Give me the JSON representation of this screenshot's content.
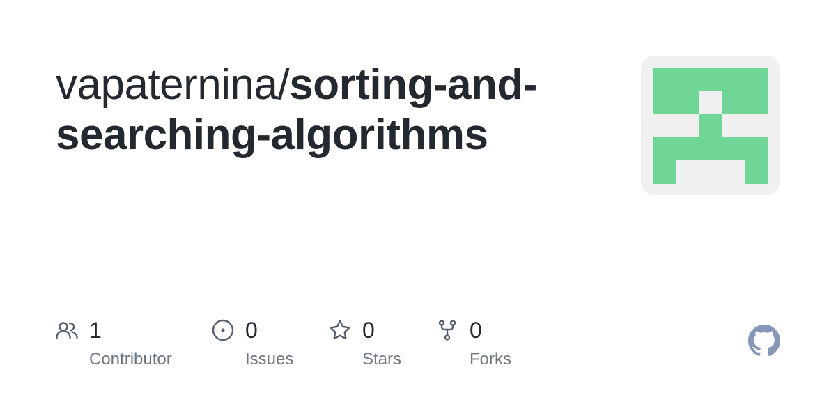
{
  "repo": {
    "owner": "vapaternina/",
    "name": "sorting-and-searching-algorithms"
  },
  "stats": [
    {
      "count": "1",
      "label": "Contributor",
      "icon": "people-icon"
    },
    {
      "count": "0",
      "label": "Issues",
      "icon": "issue-opened-icon"
    },
    {
      "count": "0",
      "label": "Stars",
      "icon": "star-icon"
    },
    {
      "count": "0",
      "label": "Forks",
      "icon": "repo-forked-icon"
    }
  ],
  "colors": {
    "text": "#24292f",
    "muted": "#6e7781",
    "icon": "#57606a",
    "avatar_background": "#f0f0f0",
    "avatar_fill": "#6fd697",
    "github_logo": "#8896b8"
  },
  "logo": "github-mark-icon"
}
